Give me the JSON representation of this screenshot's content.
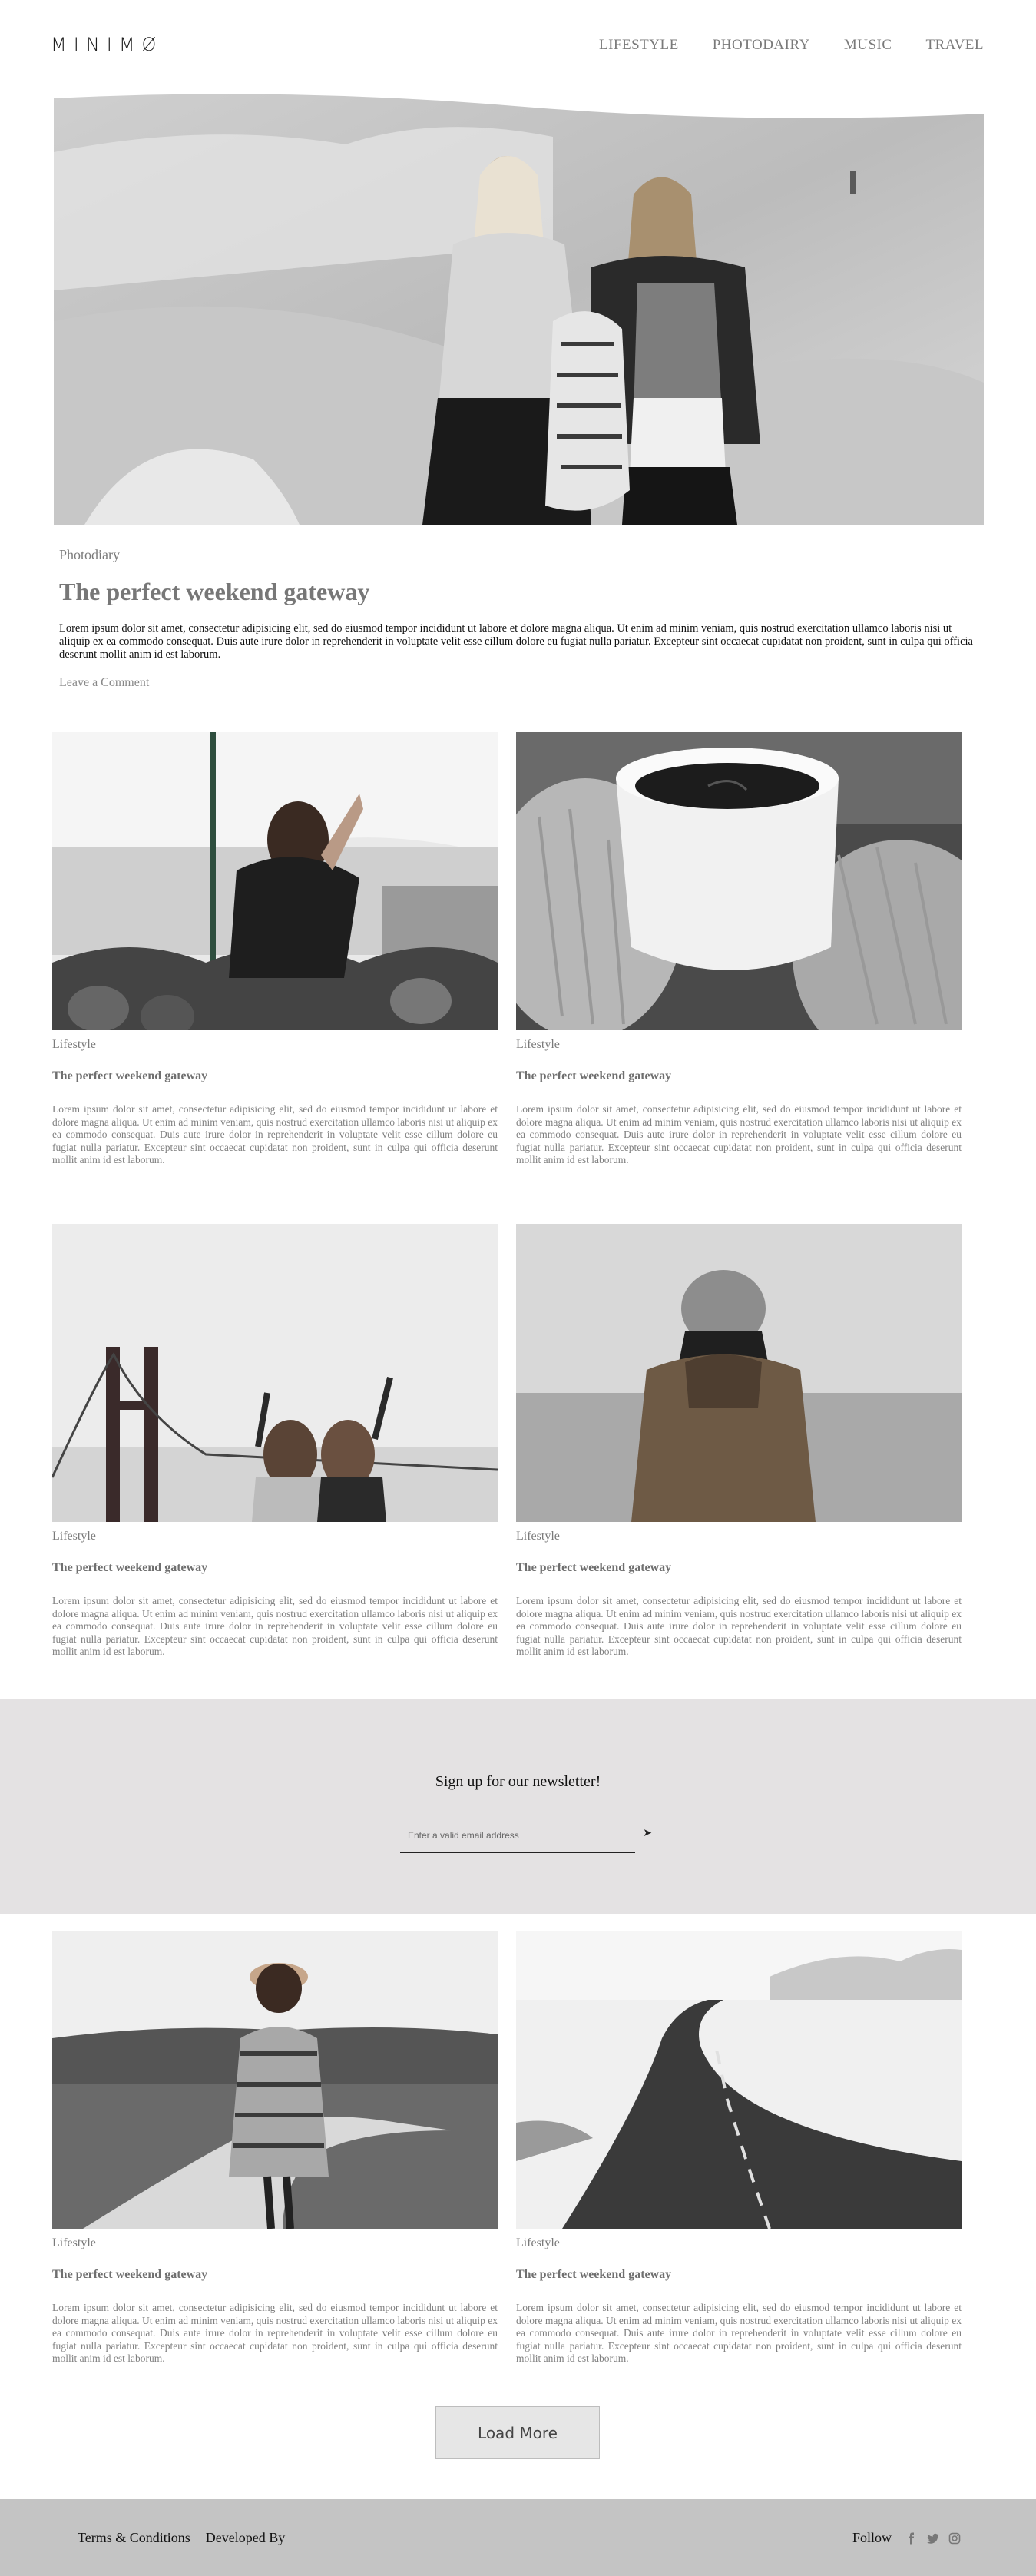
{
  "header": {
    "logo": "MINIMØ",
    "nav": [
      "LIFESTYLE",
      "PHOTODAIRY",
      "MUSIC",
      "TRAVEL"
    ]
  },
  "featured": {
    "category": "Photodiary",
    "title": "The perfect weekend gateway",
    "text": "Lorem ipsum dolor sit amet, consectetur adipisicing elit, sed do eiusmod tempor incididunt ut labore et dolore magna aliqua. Ut enim ad minim veniam, quis nostrud exercitation ullamco laboris nisi ut aliquip ex ea commodo consequat. Duis aute irure dolor in reprehenderit in voluptate velit esse cillum dolore eu fugiat nulla pariatur. Excepteur sint occaecat cupidatat non proident, sunt in culpa qui officia deserunt mollit anim id est laborum.",
    "comment": "Leave a Comment"
  },
  "posts": [
    {
      "category": "Lifestyle",
      "title": "The perfect weekend gateway",
      "text": "Lorem ipsum dolor sit amet, consectetur adipisicing elit, sed do eiusmod tempor incididunt ut labore et dolore magna aliqua. Ut enim ad minim veniam, quis nostrud exercitation ullamco laboris nisi ut aliquip ex ea commodo consequat. Duis aute irure dolor in reprehenderit in voluptate velit esse cillum dolore eu fugiat nulla pariatur. Excepteur sint occaecat cupidatat non proident, sunt in culpa qui officia deserunt mollit anim id est laborum."
    },
    {
      "category": "Lifestyle",
      "title": "The perfect weekend gateway",
      "text": "Lorem ipsum dolor sit amet, consectetur adipisicing elit, sed do eiusmod tempor incididunt ut labore et dolore magna aliqua. Ut enim ad minim veniam, quis nostrud exercitation ullamco laboris nisi ut aliquip ex ea commodo consequat. Duis aute irure dolor in reprehenderit in voluptate velit esse cillum dolore eu fugiat nulla pariatur. Excepteur sint occaecat cupidatat non proident, sunt in culpa qui officia deserunt mollit anim id est laborum."
    },
    {
      "category": "Lifestyle",
      "title": "The perfect weekend gateway",
      "text": "Lorem ipsum dolor sit amet, consectetur adipisicing elit, sed do eiusmod tempor incididunt ut labore et dolore magna aliqua. Ut enim ad minim veniam, quis nostrud exercitation ullamco laboris nisi ut aliquip ex ea commodo consequat. Duis aute irure dolor in reprehenderit in voluptate velit esse cillum dolore eu fugiat nulla pariatur. Excepteur sint occaecat cupidatat non proident, sunt in culpa qui officia deserunt mollit anim id est laborum."
    },
    {
      "category": "Lifestyle",
      "title": "The perfect weekend gateway",
      "text": "Lorem ipsum dolor sit amet, consectetur adipisicing elit, sed do eiusmod tempor incididunt ut labore et dolore magna aliqua. Ut enim ad minim veniam, quis nostrud exercitation ullamco laboris nisi ut aliquip ex ea commodo consequat. Duis aute irure dolor in reprehenderit in voluptate velit esse cillum dolore eu fugiat nulla pariatur. Excepteur sint occaecat cupidatat non proident, sunt in culpa qui officia deserunt mollit anim id est laborum."
    },
    {
      "category": "Lifestyle",
      "title": "The perfect weekend gateway",
      "text": "Lorem ipsum dolor sit amet, consectetur adipisicing elit, sed do eiusmod tempor incididunt ut labore et dolore magna aliqua. Ut enim ad minim veniam, quis nostrud exercitation ullamco laboris nisi ut aliquip ex ea commodo consequat. Duis aute irure dolor in reprehenderit in voluptate velit esse cillum dolore eu fugiat nulla pariatur. Excepteur sint occaecat cupidatat non proident, sunt in culpa qui officia deserunt mollit anim id est laborum."
    },
    {
      "category": "Lifestyle",
      "title": "The perfect weekend gateway",
      "text": "Lorem ipsum dolor sit amet, consectetur adipisicing elit, sed do eiusmod tempor incididunt ut labore et dolore magna aliqua. Ut enim ad minim veniam, quis nostrud exercitation ullamco laboris nisi ut aliquip ex ea commodo consequat. Duis aute irure dolor in reprehenderit in voluptate velit esse cillum dolore eu fugiat nulla pariatur. Excepteur sint occaecat cupidatat non proident, sunt in culpa qui officia deserunt mollit anim id est laborum."
    }
  ],
  "newsletter": {
    "title": "Sign up for our newsletter!",
    "placeholder": "Enter a valid email address",
    "send_icon": "send-arrow-icon"
  },
  "load_more": "Load More",
  "footer": {
    "terms": "Terms & Conditions",
    "developed": "Developed By",
    "follow": "Follow",
    "social_icons": [
      "facebook-icon",
      "twitter-icon",
      "instagram-icon"
    ]
  },
  "colors": {
    "newsletter_bg": "#e4e2e3",
    "footer_bg": "#c4c4c4",
    "muted_text": "#7a7a7a"
  }
}
